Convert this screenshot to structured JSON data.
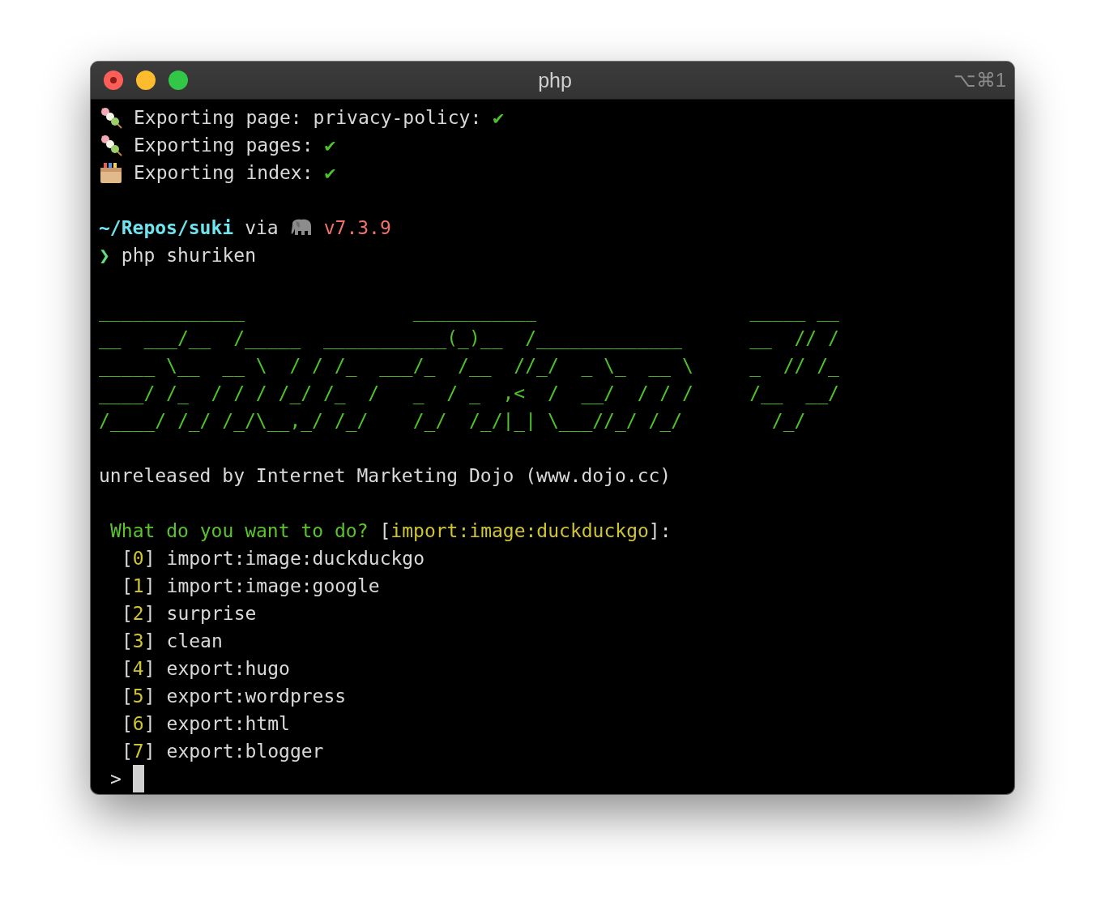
{
  "window": {
    "title": "php",
    "shortcut": "⌥⌘1"
  },
  "log": [
    {
      "text": "Exporting page: privacy-policy:",
      "check": "✔"
    },
    {
      "text": "Exporting pages:",
      "check": "✔"
    },
    {
      "text": "Exporting index:",
      "check": "✔"
    }
  ],
  "prompt": {
    "path": "~/Repos/suki",
    "via": "via",
    "version": "v7.3.9",
    "symbol": "❯",
    "command": "php shuriken"
  },
  "banner": [
    "_____________               ___________                   _____ __",
    "__  ___/__  /_____  ___________(_)__  /_____________      __  // /",
    "_____ \\__  __ \\  / / /_  ___/_  /__  //_/  _ \\_  __ \\     _  // /_",
    "____/ /_  / / / /_/ /_  /   _  / _  ,<  /  __/  / / /     /__  __/",
    "/____/ /_/ /_/\\__,_/ /_/    /_/  /_/|_| \\___//_/ /_/        /_/"
  ],
  "credit": "unreleased by Internet Marketing Dojo (www.dojo.cc)",
  "question": {
    "text": "What do you want to do?",
    "open": "[",
    "default": "import:image:duckduckgo",
    "close": "]:"
  },
  "options": [
    {
      "open": "[",
      "index": "0",
      "close": "]",
      "label": "import:image:duckduckgo"
    },
    {
      "open": "[",
      "index": "1",
      "close": "]",
      "label": "import:image:google"
    },
    {
      "open": "[",
      "index": "2",
      "close": "]",
      "label": "surprise"
    },
    {
      "open": "[",
      "index": "3",
      "close": "]",
      "label": "clean"
    },
    {
      "open": "[",
      "index": "4",
      "close": "]",
      "label": "export:hugo"
    },
    {
      "open": "[",
      "index": "5",
      "close": "]",
      "label": "export:wordpress"
    },
    {
      "open": "[",
      "index": "6",
      "close": "]",
      "label": "export:html"
    },
    {
      "open": "[",
      "index": "7",
      "close": "]",
      "label": "export:blogger"
    }
  ],
  "input": {
    "symbol": ">"
  }
}
